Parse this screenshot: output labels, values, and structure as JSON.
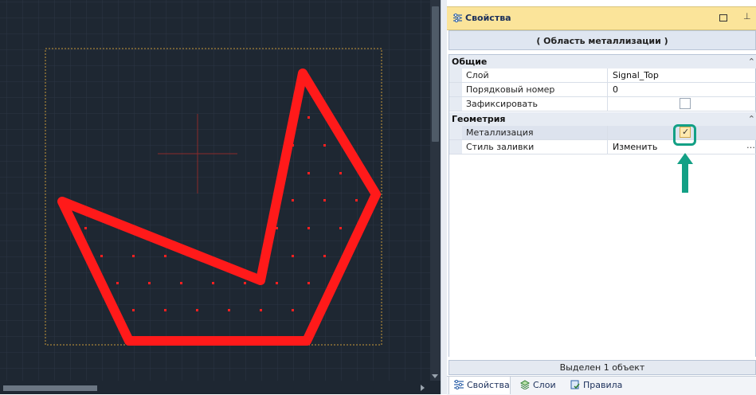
{
  "canvas": {
    "colors": {
      "background": "#1e2732",
      "outline": "#ff1a1a",
      "boundary": "#c89a3a"
    }
  },
  "panel": {
    "title": "Свойства",
    "selection_title": "( Область металлизации )",
    "categories": [
      {
        "label": "Общие",
        "rows": [
          {
            "name": "Слой",
            "value": "Signal_Top"
          },
          {
            "name": "Порядковый номер",
            "value": "0"
          },
          {
            "name": "Зафиксировать",
            "checked": false
          }
        ]
      },
      {
        "label": "Геометрия",
        "rows": [
          {
            "name": "Металлизация",
            "checked": true
          },
          {
            "name": "Стиль заливки",
            "value": "Изменить"
          }
        ]
      }
    ],
    "status": "Выделен 1 объект",
    "tabs": [
      {
        "label": "Свойства",
        "icon": "properties-icon",
        "active": true
      },
      {
        "label": "Слои",
        "icon": "layers-icon",
        "active": false
      },
      {
        "label": "Правила",
        "icon": "rules-icon",
        "active": false
      }
    ],
    "accent": "#13a085",
    "header_color": "#fbe49a"
  }
}
